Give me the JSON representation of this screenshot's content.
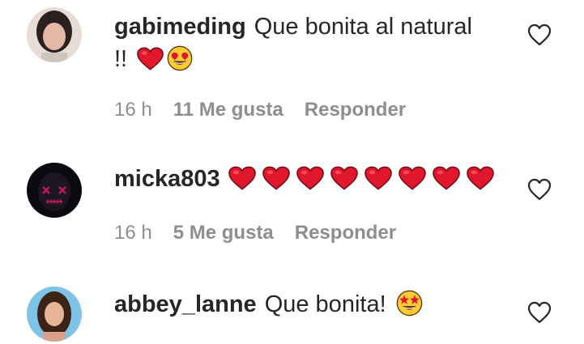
{
  "comments": [
    {
      "username": "gabimeding",
      "text_line1": "Que bonita al natural",
      "text_line2": "!!",
      "emojis": [
        "red-heart",
        "heart-eyes"
      ],
      "time": "16 h",
      "likes": "11 Me gusta",
      "reply": "Responder"
    },
    {
      "username": "micka803",
      "text": "",
      "emojis": [
        "red-heart",
        "red-heart",
        "red-heart",
        "red-heart",
        "red-heart",
        "red-heart",
        "red-heart",
        "red-heart"
      ],
      "time": "16 h",
      "likes": "5 Me gusta",
      "reply": "Responder"
    },
    {
      "username": "abbey_lanne",
      "text": "Que bonita!",
      "emojis": [
        "star-struck"
      ],
      "time": "",
      "likes": "",
      "reply": ""
    }
  ],
  "colors": {
    "text": "#262626",
    "meta": "#8e8e8e",
    "heart_emoji": "#e0172d",
    "emoji_face": "#ffcc33"
  }
}
